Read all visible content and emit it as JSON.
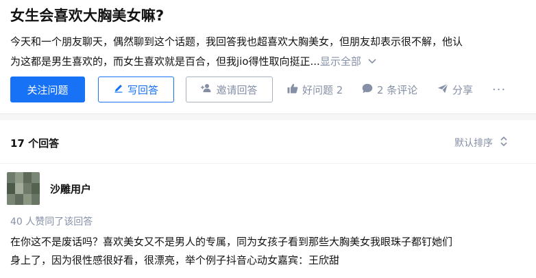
{
  "question": {
    "title": "女生会喜欢大胸美女嘛?",
    "excerpt_line1": "今天和一个朋友聊天，偶然聊到这个话题，我回答我也超喜欢大胸美女，但朋友却表示很不解，他认",
    "excerpt_line2": "为这都是男生喜欢的，而女生喜欢就是百合，但我jio得性取向挺正...",
    "show_all": "显示全部"
  },
  "actions": {
    "follow_label": "关注问题",
    "write_label": "写回答",
    "invite_label": "邀请回答",
    "good_question_label": "好问题 2",
    "comments_label": "2 条评论",
    "share_label": "分享",
    "more_label": "···"
  },
  "answers_header": {
    "count_label": "17 个回答",
    "sort_label": "默认排序"
  },
  "answer": {
    "author": "沙雕用户",
    "upvote_meta": "40 人赞同了该回答",
    "text_line1": "在你这不是废话吗？喜欢美女又不是男人的专属，同为女孩子看到那些大胸美女我眼珠子都钉她们",
    "text_line2": "身上了，因为很性感很好看，很漂亮，举个例子抖音心动女嘉宾：王欣甜"
  },
  "colors": {
    "brand_blue": "#1772f6",
    "meta_gray": "#8590a6",
    "text_dark": "#121212"
  }
}
